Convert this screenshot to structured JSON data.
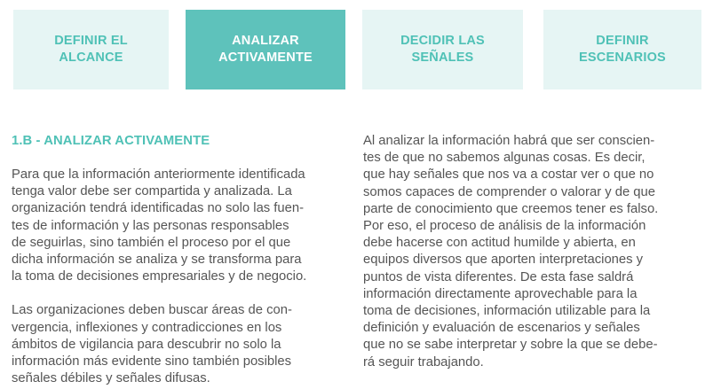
{
  "tabs": [
    {
      "label": "DEFINIR EL\nALCANCE",
      "active": false
    },
    {
      "label": "ANALIZAR\nACTIVAMENTE",
      "active": true
    },
    {
      "label": "DECIDIR LAS\nSEÑALES",
      "active": false
    },
    {
      "label": "DEFINIR\nESCENARIOS",
      "active": false
    }
  ],
  "colors": {
    "accent": "#5ec2bb",
    "accent_text": "#4fc1b6",
    "tab_inactive_bg": "#e6f5f4",
    "body_text": "#555555"
  },
  "section": {
    "heading": "1.B - ANALIZAR ACTIVAMENTE",
    "left_paragraphs": [
      [
        "Para que la información anteriormente identificada",
        "tenga valor debe ser compartida y analizada. La",
        "organización tendrá identificadas no solo las fuen-",
        "tes de información y las personas responsables",
        "de seguirlas, sino también el proceso por el que",
        "dicha información se analiza y se transforma para",
        "la toma de decisiones empresariales y de negocio."
      ],
      [
        "Las organizaciones deben buscar áreas de con-",
        "vergencia, inflexiones y contradicciones en los",
        "ámbitos de vigilancia para descubrir no solo la",
        "información más evidente sino también posibles",
        "señales débiles y señales difusas."
      ]
    ],
    "right_paragraph": [
      "Al analizar la información habrá que ser conscien-",
      "tes de que no sabemos algunas cosas. Es decir,",
      "que hay señales que nos va a costar ver o que no",
      "somos capaces de comprender o valorar y de que",
      "parte de conocimiento que creemos tener es falso.",
      "Por eso, el proceso de análisis de la información",
      "debe hacerse con actitud humilde y abierta, en",
      "equipos diversos que aporten interpretaciones y",
      "puntos de vista diferentes. De esta fase saldrá",
      "información directamente aprovechable para la",
      "toma de decisiones, información utilizable para la",
      "definición y evaluación de escenarios y señales",
      "que no se sabe interpretar y sobre la que se debe-",
      "rá seguir trabajando."
    ]
  }
}
